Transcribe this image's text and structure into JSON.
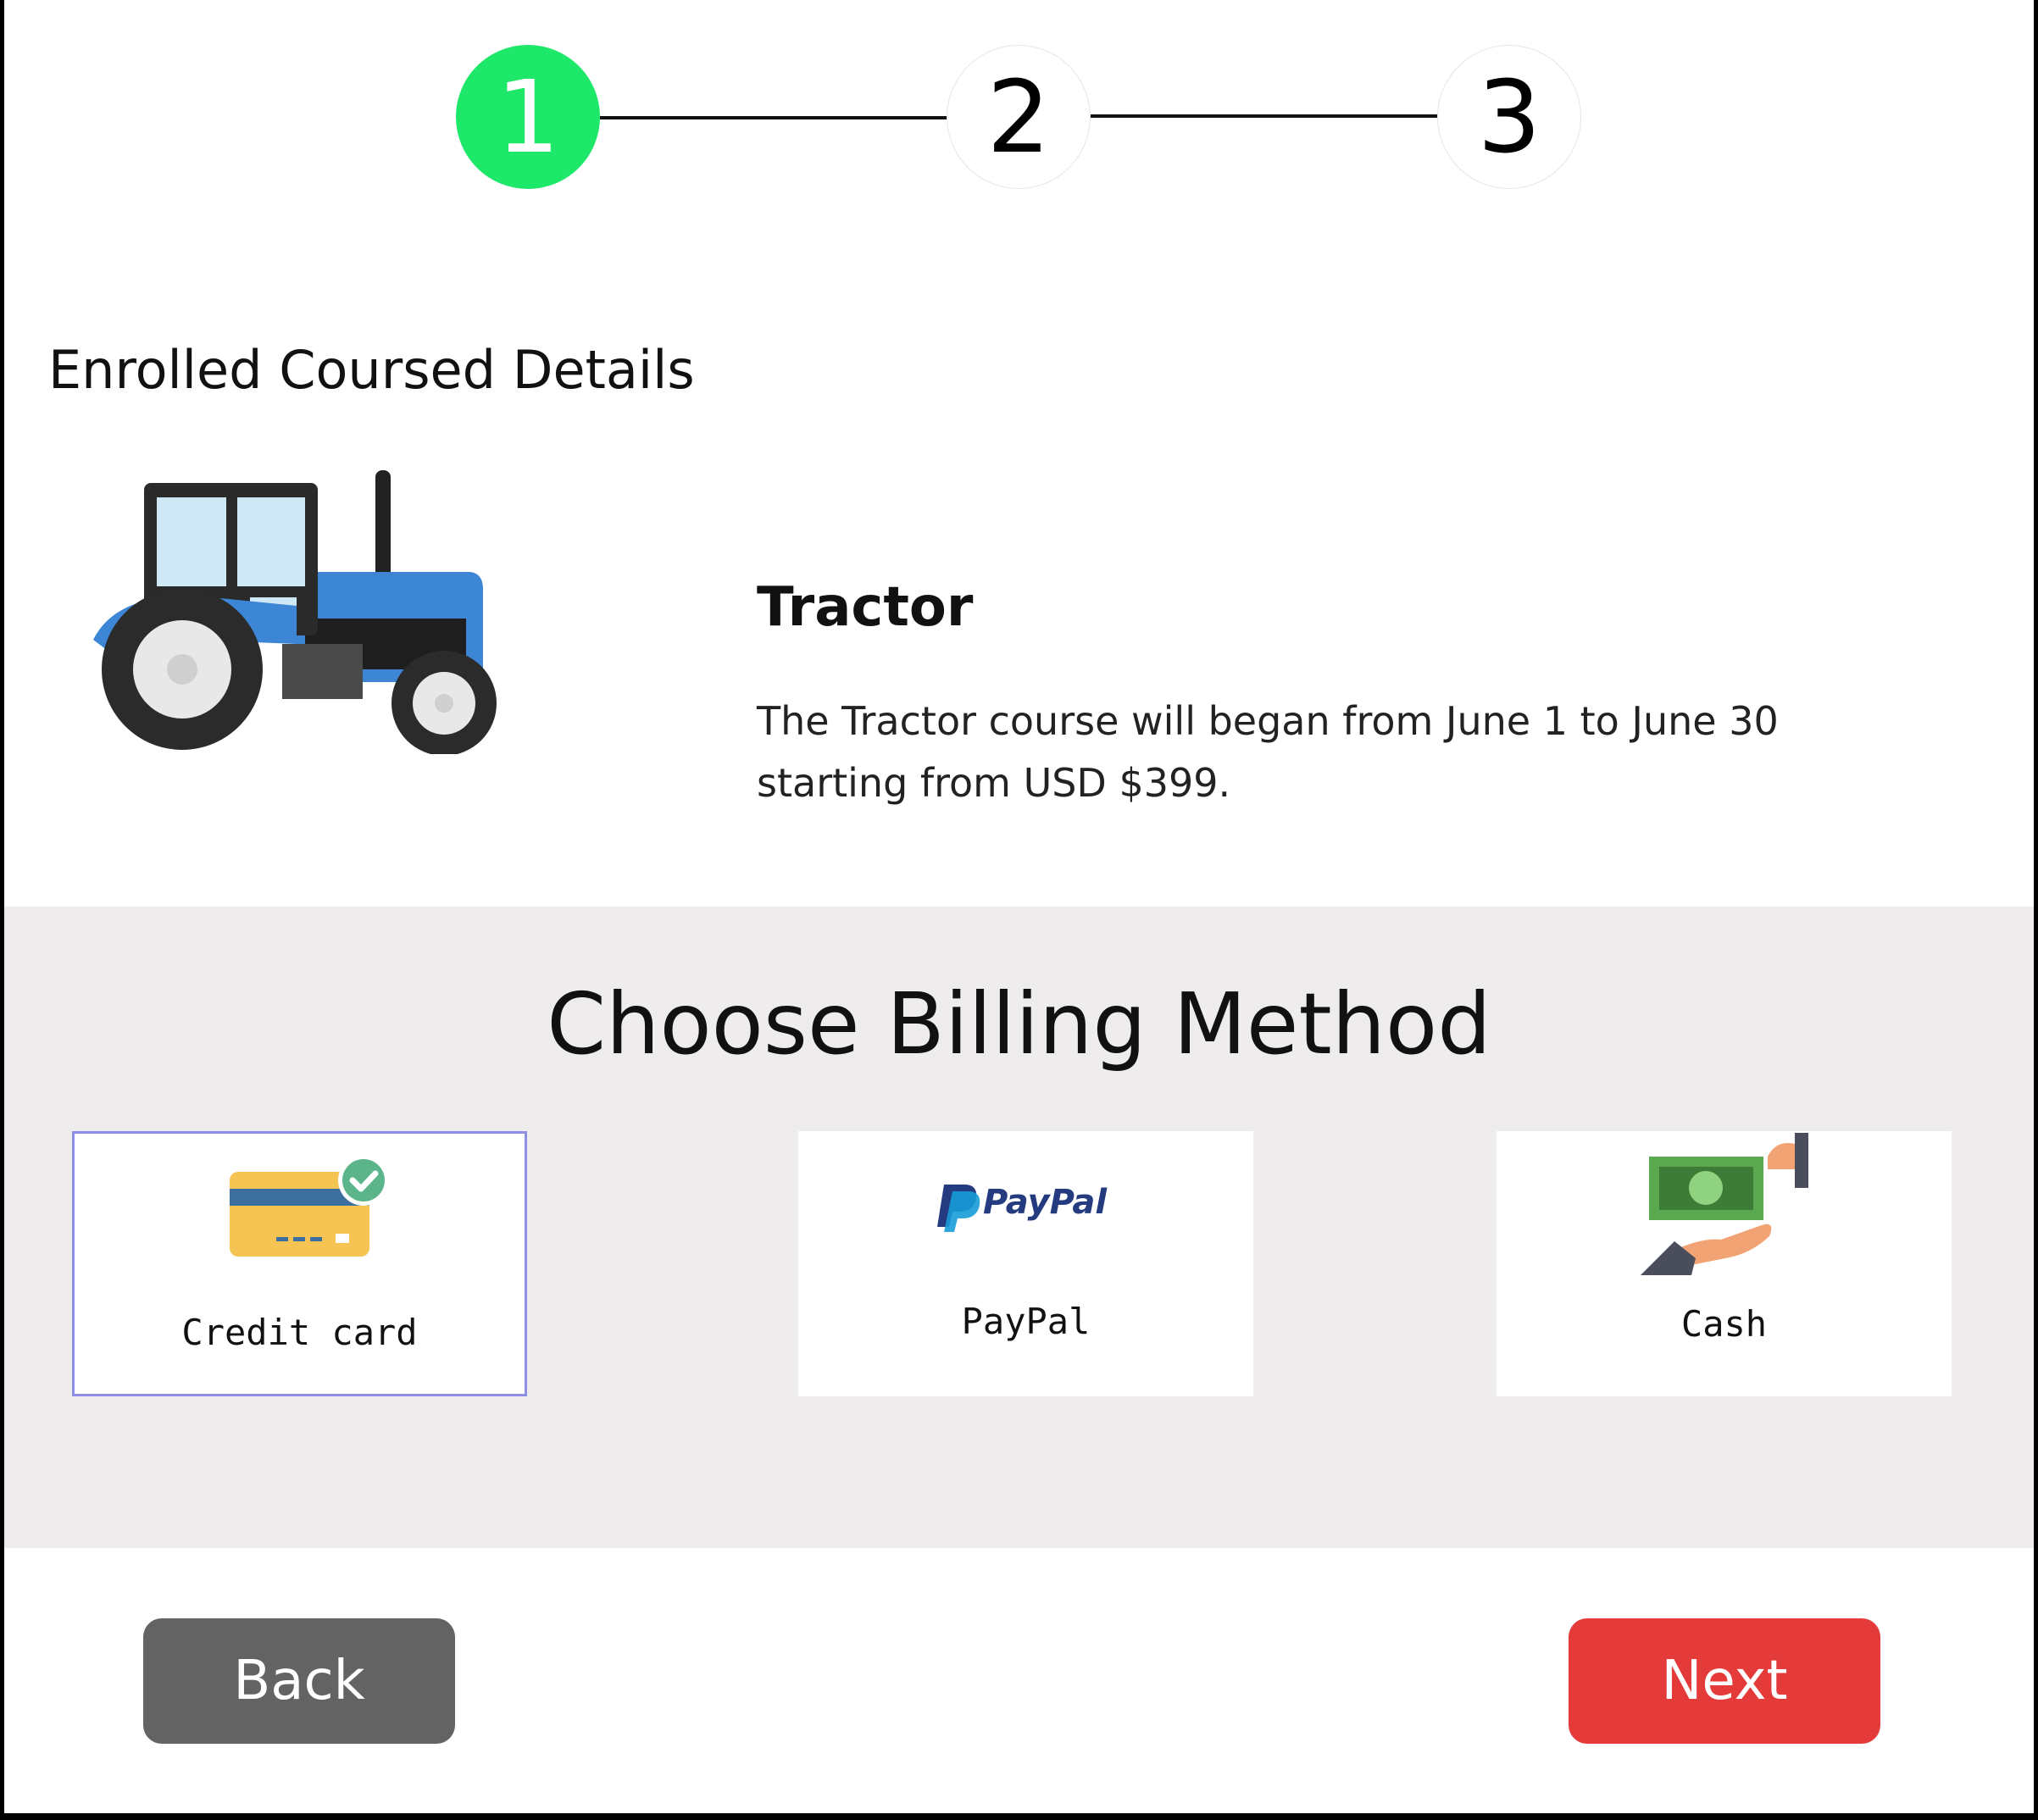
{
  "stepper": {
    "steps": [
      "1",
      "2",
      "3"
    ],
    "active_step": 1,
    "active_color": "#1ee86a"
  },
  "course_section": {
    "title": "Enrolled Coursed Details",
    "image_icon": "tractor-image",
    "course_name": "Tractor",
    "description": "The Tractor course will began from June 1 to June 30 starting from USD $399."
  },
  "billing": {
    "title": "Choose Billing Method",
    "methods": [
      {
        "label": "Credit card",
        "icon": "credit-card-icon",
        "selected": true
      },
      {
        "label": "PayPal",
        "icon": "paypal-logo",
        "logo_text": "PayPal",
        "selected": false
      },
      {
        "label": "Cash",
        "icon": "cash-hand-icon",
        "selected": false
      }
    ],
    "selected_border_color": "#8e8ee6",
    "background_color": "#eeeced"
  },
  "actions": {
    "back_label": "Back",
    "next_label": "Next",
    "back_color": "#636363",
    "next_color": "#e43a3a"
  }
}
